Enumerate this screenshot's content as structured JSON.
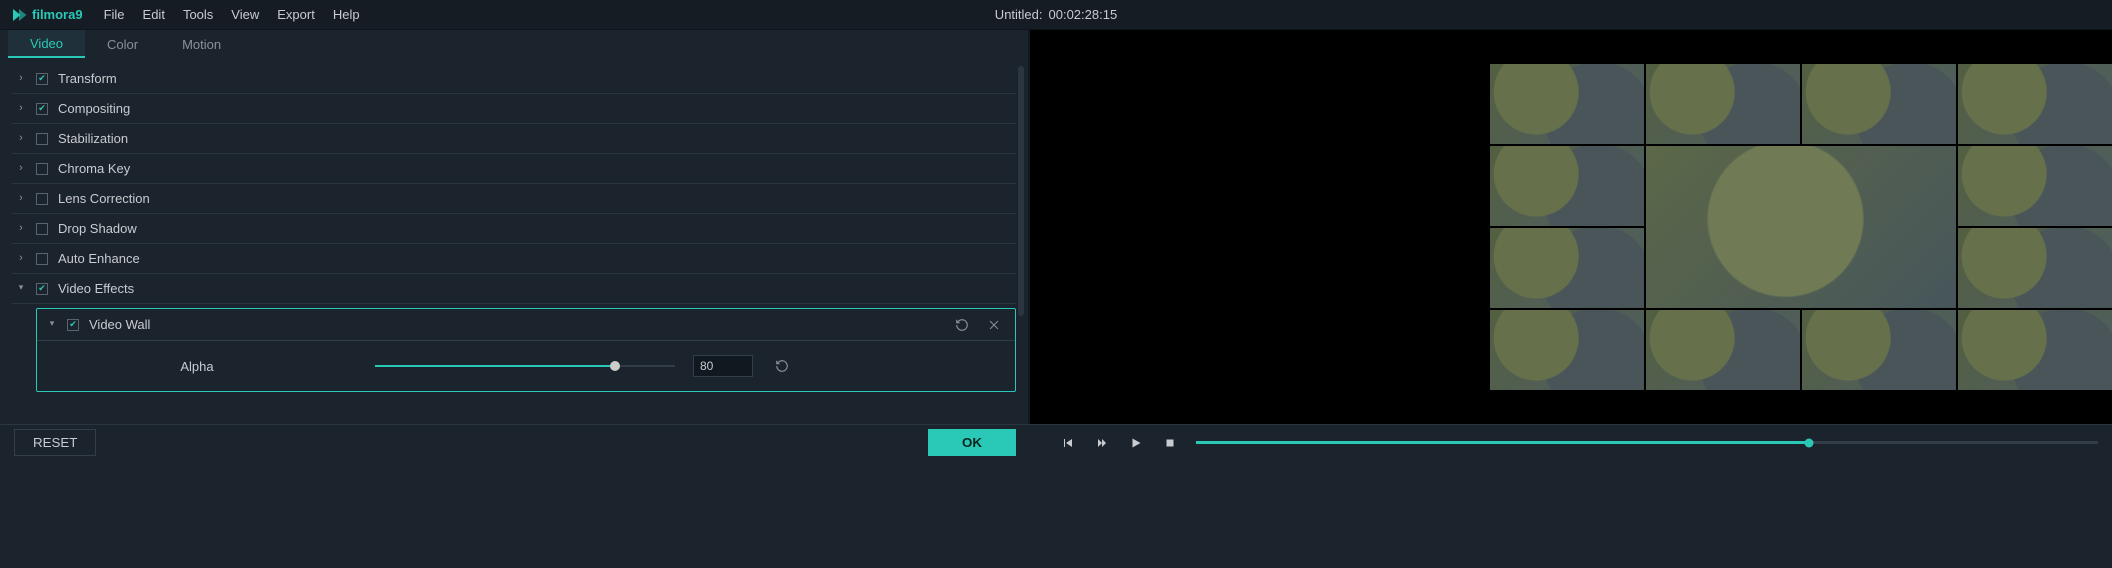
{
  "brand": "filmora9",
  "menu": {
    "file": "File",
    "edit": "Edit",
    "tools": "Tools",
    "view": "View",
    "export": "Export",
    "help": "Help"
  },
  "project": {
    "name": "Untitled:",
    "time": "00:02:28:15"
  },
  "tabs": {
    "video": "Video",
    "color": "Color",
    "motion": "Motion"
  },
  "sections": {
    "transform": "Transform",
    "compositing": "Compositing",
    "stabilization": "Stabilization",
    "chroma_key": "Chroma Key",
    "lens_correction": "Lens Correction",
    "drop_shadow": "Drop Shadow",
    "auto_enhance": "Auto Enhance",
    "video_effects": "Video Effects"
  },
  "effect": {
    "name": "Video Wall",
    "param_label": "Alpha",
    "param_value": "80"
  },
  "footer": {
    "reset": "RESET",
    "ok": "OK"
  }
}
